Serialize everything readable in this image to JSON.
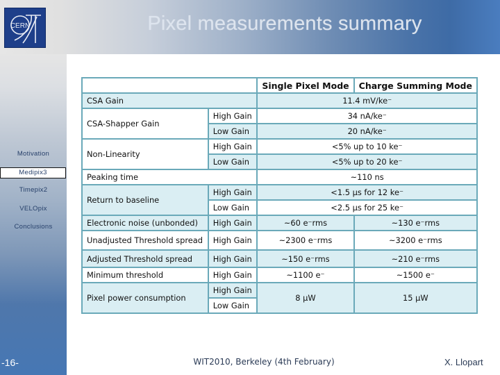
{
  "header": {
    "logo_text": "CERN",
    "logo_icon": "cern-logo",
    "title": "Pixel measurements summary"
  },
  "sidebar": {
    "items": [
      {
        "label": "Motivation",
        "active": false
      },
      {
        "label": "Medipix3",
        "active": true
      },
      {
        "label": "Timepix2",
        "active": false
      },
      {
        "label": "VELOpix",
        "active": false
      },
      {
        "label": "Conclusions",
        "active": false
      }
    ],
    "page_number": "-16-"
  },
  "table": {
    "columns": [
      "",
      "",
      "Single Pixel Mode",
      "Charge Summing Mode"
    ],
    "rows": [
      {
        "param": "CSA Gain",
        "sub": "",
        "value": "11.4 mV/ke⁻"
      },
      {
        "param": "CSA-Shapper Gain",
        "sub": "High Gain",
        "value": "34 nA/ke⁻"
      },
      {
        "param": "",
        "sub": "Low Gain",
        "value": "20 nA/ke⁻"
      },
      {
        "param": "Non-Linearity",
        "sub": "High Gain",
        "value": "<5% up to 10 ke⁻"
      },
      {
        "param": "",
        "sub": "Low Gain",
        "value": "<5% up to 20 ke⁻"
      },
      {
        "param": "Peaking time",
        "sub": "",
        "value": "~110 ns"
      },
      {
        "param": "Return to baseline",
        "sub": "High Gain",
        "value": "<1.5 µs for 12 ke⁻"
      },
      {
        "param": "",
        "sub": "Low Gain",
        "value": "<2.5 µs for 25 ke⁻"
      },
      {
        "param": "Electronic noise (unbonded)",
        "sub": "High Gain",
        "spm": "~60 e⁻rms",
        "csm": "~130 e⁻rms"
      },
      {
        "param": "Unadjusted Threshold spread",
        "sub": "High Gain",
        "spm": "~2300 e⁻rms",
        "csm": "~3200 e⁻rms"
      },
      {
        "param": "Adjusted Threshold spread",
        "sub": "High Gain",
        "spm": "~150 e⁻rms",
        "csm": "~210 e⁻rms"
      },
      {
        "param": "Minimum threshold",
        "sub": "High Gain",
        "spm": "~1100 e⁻",
        "csm": "~1500 e⁻"
      },
      {
        "param": "Pixel power consumption",
        "sub": "High Gain",
        "spm": "8 µW",
        "csm": "15 µW"
      },
      {
        "param": "",
        "sub": "Low Gain"
      }
    ]
  },
  "footer": {
    "event": "WIT2010, Berkeley (4th February)",
    "author": "X. Llopart"
  },
  "colors": {
    "table_border": "#6aa9b9",
    "row_shade": "#daeef3",
    "header_blue": "#3e6ba6",
    "logo_blue": "#1e3f8a"
  }
}
